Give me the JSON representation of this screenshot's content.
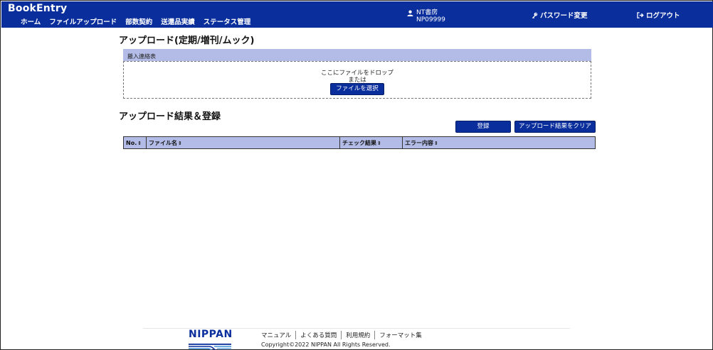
{
  "header": {
    "brand": "BookEntry",
    "nav": [
      "ホーム",
      "ファイルアップロード",
      "部数契約",
      "送還品実績",
      "ステータス管理"
    ],
    "user": {
      "name": "NT書房",
      "code": "NP09999"
    },
    "password_change": "パスワード変更",
    "logout": "ログアウト",
    "bg_color": "#0a2e9c"
  },
  "upload": {
    "title": "アップロード(定期/増刊/ムック)",
    "panel_label": "搬入連絡表",
    "drop_text": "ここにファイルをドロップ",
    "or_text": "または",
    "select_button": "ファイルを選択"
  },
  "results": {
    "title": "アップロード結果＆登録",
    "register_button": "登録",
    "clear_button": "アップロード結果をクリア",
    "columns": [
      "No.",
      "ファイル名",
      "チェック結果",
      "エラー内容"
    ],
    "sort_icon": "⇕"
  },
  "footer": {
    "logo": "NIPPAN",
    "links": [
      "マニュアル",
      "よくある質問",
      "利用規約",
      "フォーマット集"
    ],
    "copyright": "Copyright©2022 NIPPAN All Rights Reserved."
  }
}
